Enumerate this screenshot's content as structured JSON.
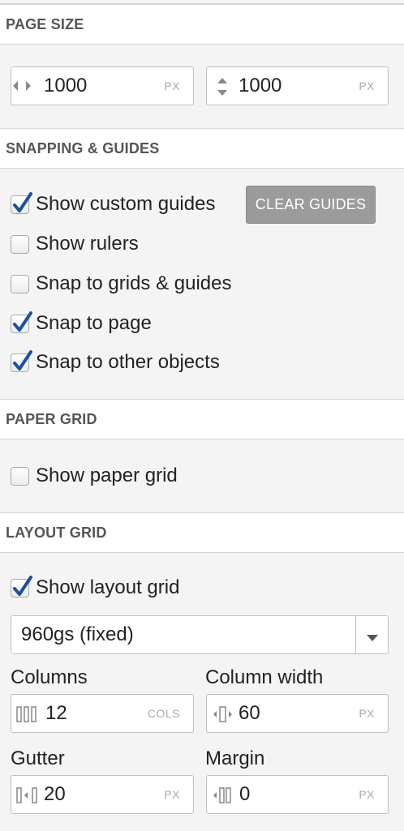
{
  "page_size": {
    "header": "Page Size",
    "width": {
      "value": "1000",
      "unit": "PX",
      "icon": "horizontal-resize-icon"
    },
    "height": {
      "value": "1000",
      "unit": "PX",
      "icon": "vertical-resize-icon"
    }
  },
  "snapping": {
    "header": "Snapping & Guides",
    "clear_guides_label": "Clear Guides",
    "items": [
      {
        "label": "Show custom guides",
        "checked": true
      },
      {
        "label": "Show rulers",
        "checked": false
      },
      {
        "label": "Snap to grids & guides",
        "checked": false
      },
      {
        "label": "Snap to page",
        "checked": true
      },
      {
        "label": "Snap to other objects",
        "checked": true
      }
    ]
  },
  "paper_grid": {
    "header": "Paper Grid",
    "show_label": "Show paper grid",
    "checked": false
  },
  "layout_grid": {
    "header": "Layout Grid",
    "show_label": "Show layout grid",
    "checked": true,
    "preset": "960gs (fixed)",
    "columns": {
      "label": "Columns",
      "value": "12",
      "unit": "COLS",
      "icon": "columns-icon"
    },
    "column_width": {
      "label": "Column width",
      "value": "60",
      "unit": "PX",
      "icon": "column-width-icon"
    },
    "gutter": {
      "label": "Gutter",
      "value": "20",
      "unit": "PX",
      "icon": "gutter-icon"
    },
    "margin": {
      "label": "Margin",
      "value": "0",
      "unit": "PX",
      "icon": "margin-icon"
    }
  },
  "colors": {
    "checkmark": "#1d4f9c",
    "button_bg": "#9b9b9b"
  }
}
